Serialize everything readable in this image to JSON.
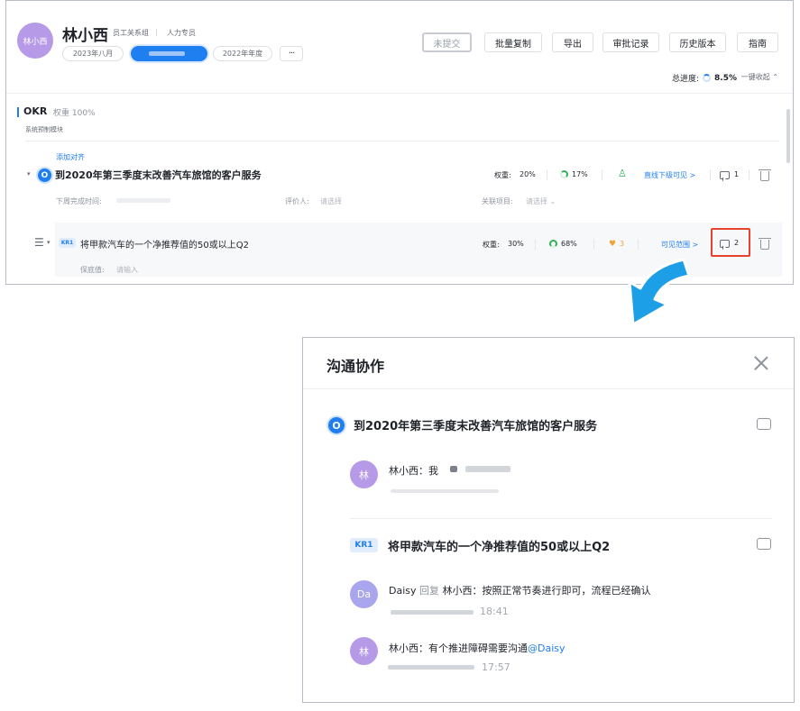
{
  "header": {
    "avatar_text": "林小西",
    "name": "林小西",
    "department": "员工关系组",
    "role": "人力专员",
    "month_chip": "2023年八月",
    "year_chip": "2022年年度",
    "more_label": "···"
  },
  "toolbar": {
    "unsubmit": "未提交",
    "batch_copy": "批量复制",
    "export": "导出",
    "approval_records": "审批记录",
    "history": "历史版本",
    "guide": "指南"
  },
  "summary": {
    "progress_label": "总进度:",
    "progress_value": "8.5%",
    "collapse_label": "一键收起 ⌃"
  },
  "okr_section": {
    "title": "OKR",
    "weight": "权重 100%",
    "subtitle": "系统预制模块"
  },
  "objective": {
    "add_align": "添加对齐",
    "badge": "O",
    "title": "到2020年第三季度末改善汽车旅馆的客户服务",
    "weight_label": "权重:",
    "weight_value": "20%",
    "progress": "17%",
    "visibility": "直线下级可见 >",
    "comment_count": "1",
    "deadline_label": "下周完成时间:",
    "reviewer_label": "评价人:",
    "reviewer_placeholder": "请选择",
    "project_label": "关联项目:",
    "project_placeholder": "请选择 ⌄"
  },
  "key_result": {
    "badge": "KR1",
    "title": "将甲款汽车的一个净推荐值的50或以上Q2",
    "weight_label": "权重:",
    "weight_value": "30%",
    "progress": "68%",
    "likes": "3",
    "visibility": "可见范围 >",
    "comment_count": "2",
    "floor_label": "保底值:",
    "floor_placeholder": "请输入"
  },
  "panel": {
    "title": "沟通协作",
    "objective_badge": "O",
    "objective_title": "到2020年第三季度末改善汽车旅馆的客户服务",
    "kr_badge": "KR1",
    "kr_title": "将甲款汽车的一个净推荐值的50或以上Q2",
    "comments": [
      {
        "avatar": "林",
        "author": "林小西",
        "text": "林小西：我",
        "time": ""
      },
      {
        "avatar": "Da",
        "author": "Daisy",
        "reply_word": "回复",
        "text": "林小西：按照正常节奏进行即可，流程已经确认",
        "time": "18:41"
      },
      {
        "avatar": "林",
        "author": "林小西",
        "text": "林小西：有个推进障碍需要沟通",
        "mention": "@Daisy",
        "time": "17:57"
      }
    ]
  },
  "colors": {
    "accent": "#1f7ef0",
    "avatar": "#b69ae8",
    "highlight": "#e8422f",
    "arrow": "#1d9fe8"
  }
}
